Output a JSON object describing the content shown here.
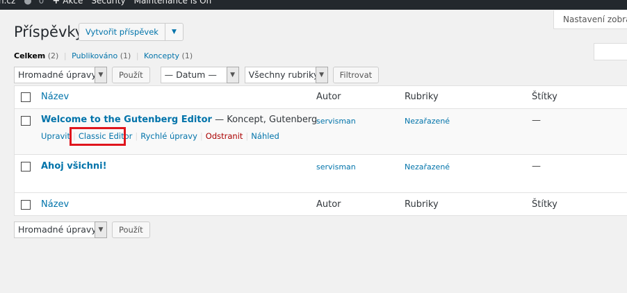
{
  "adminbar": {
    "site": "n.cz",
    "comments_count": "0",
    "new_label": "Akce",
    "security": "Security",
    "maintenance": "Maintenance is On"
  },
  "screen_options": "Nastavení zobrazení",
  "page_title": "Příspěvky",
  "add_new": "Vytvořit příspěvek",
  "filters": {
    "all": "Celkem",
    "all_count": "(2)",
    "published": "Publikováno",
    "published_count": "(1)",
    "drafts": "Koncepty",
    "drafts_count": "(1)"
  },
  "tablenav": {
    "bulk_select": "Hromadné úpravy",
    "apply": "Použít",
    "date_select": "— Datum —",
    "category_select": "Všechny rubriky",
    "filter": "Filtrovat"
  },
  "columns": {
    "title": "Název",
    "author": "Autor",
    "categories": "Rubriky",
    "tags": "Štítky"
  },
  "posts": [
    {
      "title": "Welcome to the Gutenberg Editor",
      "state": " — Koncept, Gutenberg",
      "author": "servisman",
      "category": "Nezařazené",
      "tags": "—",
      "actions": {
        "edit": "Upravit",
        "classic": "Classic Editor",
        "quick": "Rychlé úpravy",
        "trash": "Odstranit",
        "preview": "Náhled"
      }
    },
    {
      "title": "Ahoj všichni!",
      "state": "",
      "author": "servisman",
      "category": "Nezařazené",
      "tags": "—"
    }
  ],
  "colors": {
    "link": "#0073aa",
    "delete": "#a00",
    "highlight": "#e0151d",
    "adminbar": "#23282d"
  }
}
